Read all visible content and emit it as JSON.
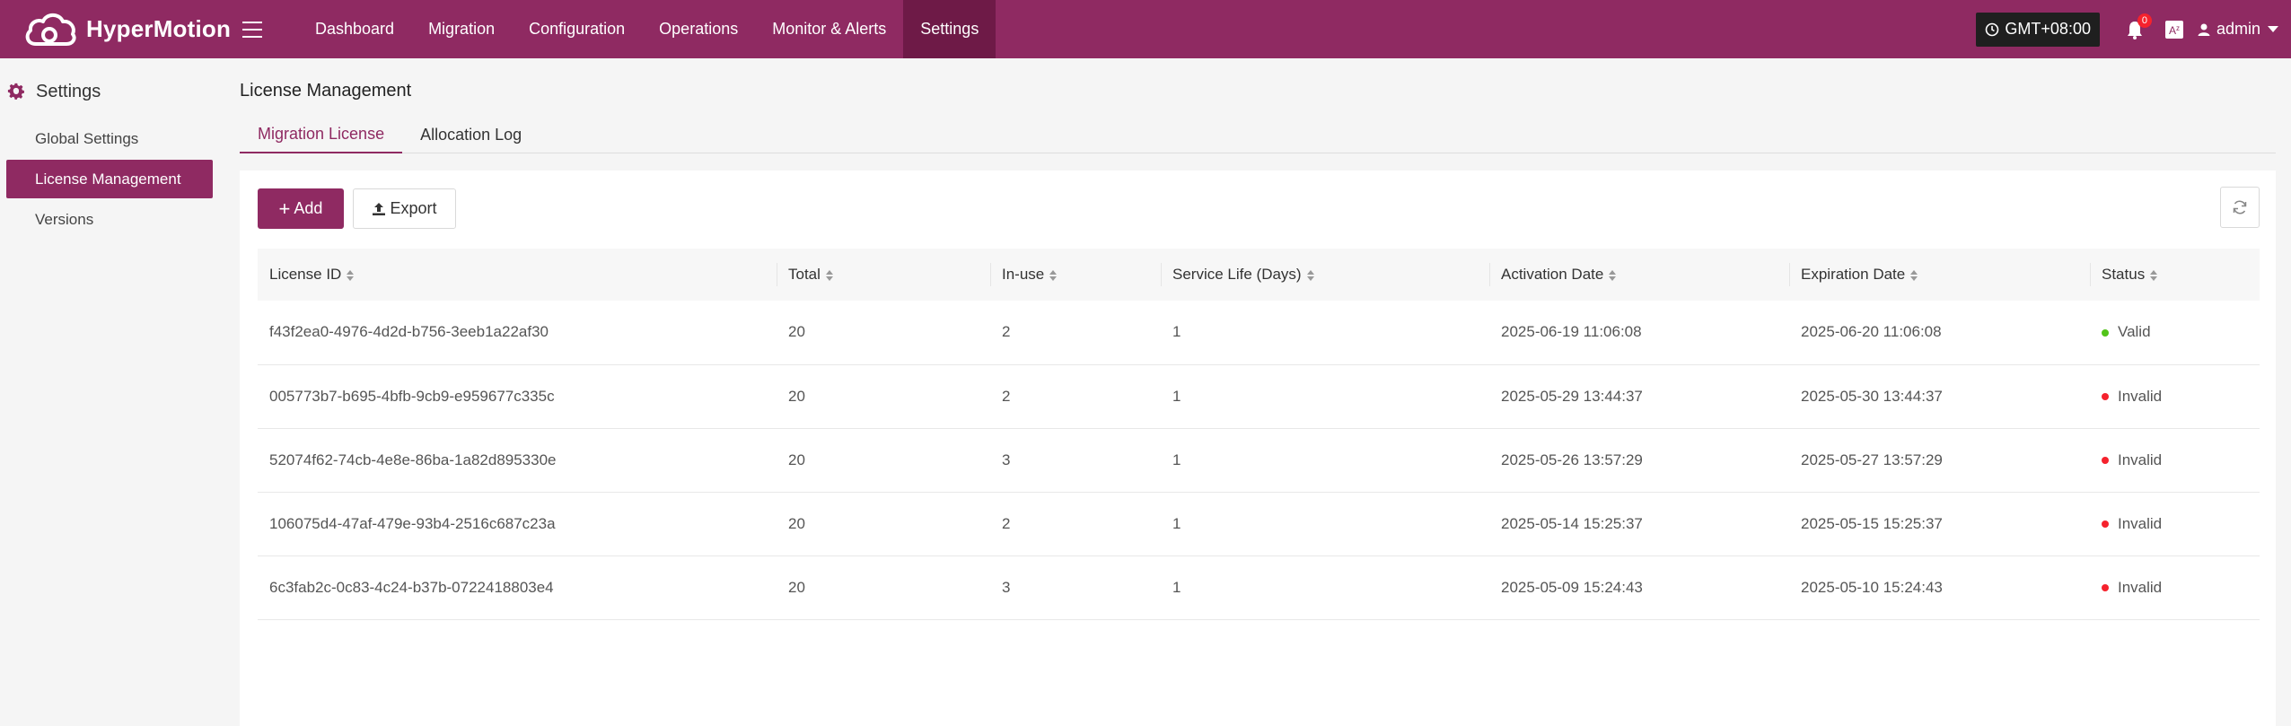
{
  "brand": {
    "name": "HyperMotion"
  },
  "nav": [
    {
      "label": "Dashboard"
    },
    {
      "label": "Migration"
    },
    {
      "label": "Configuration"
    },
    {
      "label": "Operations"
    },
    {
      "label": "Monitor & Alerts"
    },
    {
      "label": "Settings",
      "active": true
    }
  ],
  "topbar": {
    "timezone": "GMT+08:00",
    "alert_count": "0",
    "user": "admin"
  },
  "sidebar": {
    "title": "Settings",
    "items": [
      {
        "label": "Global Settings"
      },
      {
        "label": "License Management",
        "active": true
      },
      {
        "label": "Versions"
      }
    ]
  },
  "page": {
    "title": "License Management",
    "tabs": [
      {
        "label": "Migration License",
        "active": true
      },
      {
        "label": "Allocation Log"
      }
    ]
  },
  "toolbar": {
    "add_label": "Add",
    "export_label": "Export"
  },
  "table": {
    "columns": [
      "License ID",
      "Total",
      "In-use",
      "Service Life (Days)",
      "Activation Date",
      "Expiration Date",
      "Status"
    ],
    "rows": [
      {
        "id": "f43f2ea0-4976-4d2d-b756-3eeb1a22af30",
        "total": "20",
        "in_use": "2",
        "life": "1",
        "activation": "2025-06-19 11:06:08",
        "expiration": "2025-06-20 11:06:08",
        "status": "Valid",
        "status_color": "#52c41a"
      },
      {
        "id": "005773b7-b695-4bfb-9cb9-e959677c335c",
        "total": "20",
        "in_use": "2",
        "life": "1",
        "activation": "2025-05-29 13:44:37",
        "expiration": "2025-05-30 13:44:37",
        "status": "Invalid",
        "status_color": "#f5222d"
      },
      {
        "id": "52074f62-74cb-4e8e-86ba-1a82d895330e",
        "total": "20",
        "in_use": "3",
        "life": "1",
        "activation": "2025-05-26 13:57:29",
        "expiration": "2025-05-27 13:57:29",
        "status": "Invalid",
        "status_color": "#f5222d"
      },
      {
        "id": "106075d4-47af-479e-93b4-2516c687c23a",
        "total": "20",
        "in_use": "2",
        "life": "1",
        "activation": "2025-05-14 15:25:37",
        "expiration": "2025-05-15 15:25:37",
        "status": "Invalid",
        "status_color": "#f5222d"
      },
      {
        "id": "6c3fab2c-0c83-4c24-b37b-0722418803e4",
        "total": "20",
        "in_use": "3",
        "life": "1",
        "activation": "2025-05-09 15:24:43",
        "expiration": "2025-05-10 15:24:43",
        "status": "Invalid",
        "status_color": "#f5222d"
      }
    ]
  },
  "colors": {
    "brand": "#8f2a62",
    "brand_dark": "#6e1a47"
  }
}
